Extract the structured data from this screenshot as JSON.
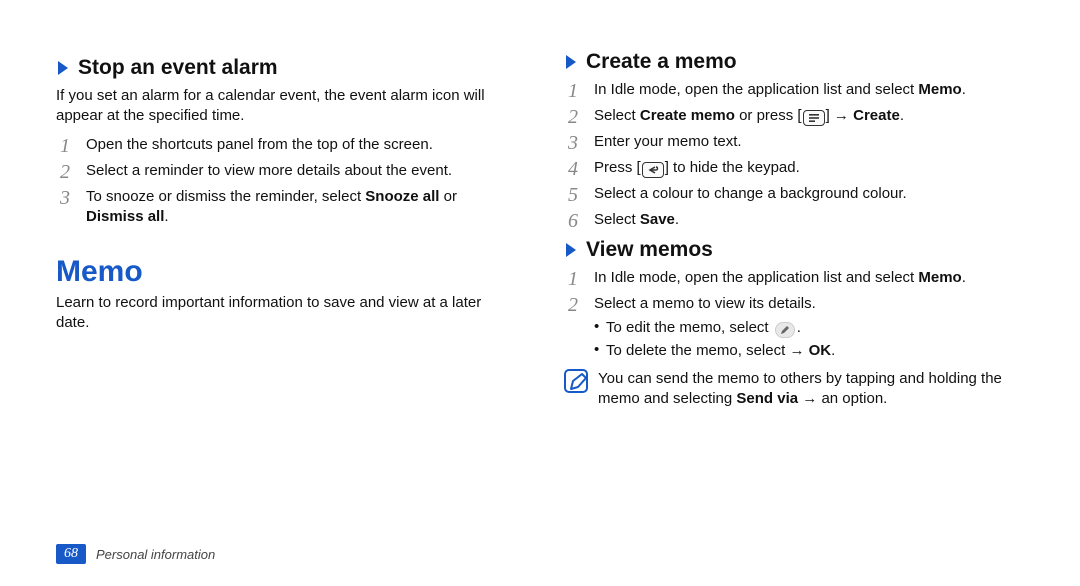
{
  "page_number": "68",
  "section_footer": "Personal information",
  "headings": {
    "stop_alarm": "Stop an event alarm",
    "memo": "Memo",
    "create_memo": "Create a memo",
    "view_memos": "View memos"
  },
  "text": {
    "stop_alarm_intro": "If you set an alarm for a calendar event, the event alarm icon will appear at the specified time.",
    "memo_intro": "Learn to record important information to save and view at a later date."
  },
  "stop_alarm_steps": {
    "s1": "Open the shortcuts panel from the top of the screen.",
    "s2": "Select a reminder to view more details about the event.",
    "s3_pre": "To snooze or dismiss the reminder, select ",
    "s3_b1": "Snooze all",
    "s3_mid": " or ",
    "s3_b2": "Dismiss all",
    "s3_end": "."
  },
  "create_memo_steps": {
    "s1_pre": "In Idle mode, open the application list and select ",
    "s1_b": "Memo",
    "s1_end": ".",
    "s2_pre": "Select ",
    "s2_b": "Create memo",
    "s2_mid": " or press [",
    "s2_arrow": " → ",
    "s2_b2": "Create",
    "s2_end": ".",
    "s3": "Enter your memo text.",
    "s4_pre": "Press [",
    "s4_post": "] to hide the keypad.",
    "s5": "Select a colour to change a background colour.",
    "s6_pre": "Select ",
    "s6_b": "Save",
    "s6_end": "."
  },
  "view_memos_steps": {
    "s1_pre": "In Idle mode, open the application list and select ",
    "s1_b": "Memo",
    "s1_end": ".",
    "s2": "Select a memo to view its details.",
    "bul_edit_pre": "To edit the memo, select ",
    "bul_edit_post": ".",
    "bul_del_pre": "To delete the memo, select ",
    "bul_del_arrow": " → ",
    "bul_del_b": "OK",
    "bul_del_end": "."
  },
  "note": {
    "pre": "You can send the memo to others by tapping and holding the memo and selecting ",
    "b1": "Send via",
    "arrow": " → ",
    "post": "an option."
  }
}
